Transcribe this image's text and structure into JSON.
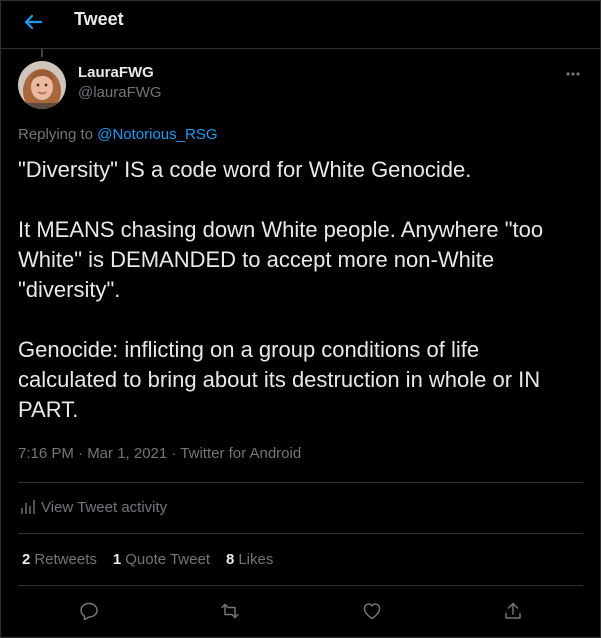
{
  "header": {
    "title": "Tweet",
    "back_icon": "arrow-left-icon"
  },
  "tweet": {
    "display_name": "LauraFWG",
    "handle": "@lauraFWG",
    "replying_prefix": "Replying to",
    "replying_to": "@Notorious_RSG",
    "paragraphs": [
      "\"Diversity\" IS a code word for White Genocide.",
      "It MEANS chasing down White people. Anywhere \"too White\" is DEMANDED to accept more non-White \"diversity\".",
      "Genocide: inflicting on a group conditions of life calculated to bring about its destruction in whole or IN PART."
    ],
    "meta": "7:16 PM · Mar 1, 2021 · Twitter for Android"
  },
  "activity": {
    "label": "View Tweet activity",
    "icon": "bar-chart-icon"
  },
  "stats": [
    {
      "count": "2",
      "label": "Retweets"
    },
    {
      "count": "1",
      "label": "Quote Tweet"
    },
    {
      "count": "8",
      "label": "Likes"
    }
  ],
  "actions": [
    "reply-icon",
    "retweet-icon",
    "like-icon",
    "share-icon"
  ],
  "colors": {
    "background": "#000000",
    "text": "#e7e9ea",
    "secondary": "#71767b",
    "accent": "#1d9bf0",
    "border": "#2f3336"
  }
}
